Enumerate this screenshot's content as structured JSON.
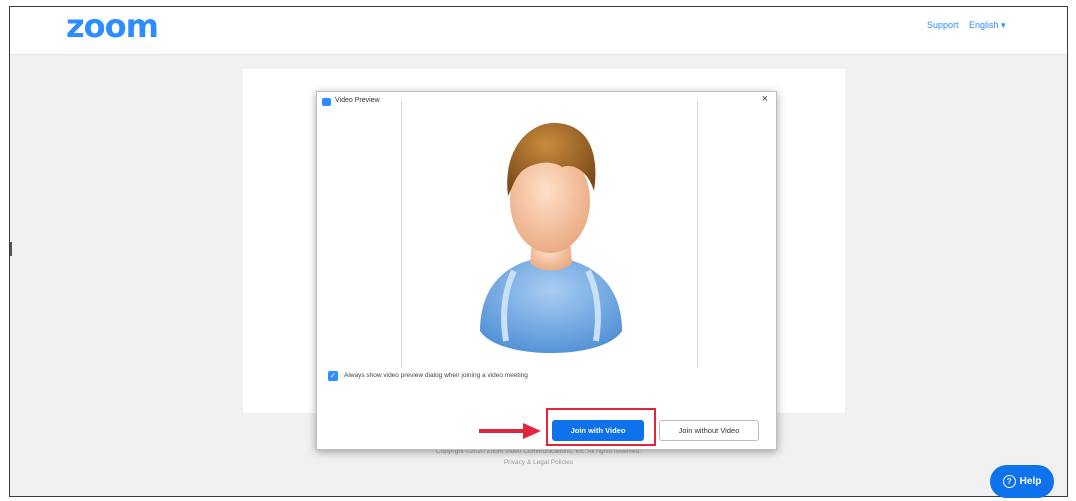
{
  "header": {
    "logo": "zoom",
    "support": "Support",
    "language": "English ▾"
  },
  "dialog": {
    "title": "Video Preview",
    "close": "×",
    "checkbox_label": "Always show video preview dialog when joining a video meeting",
    "join_with_video": "Join with Video",
    "join_without_video": "Join without Video"
  },
  "footer": {
    "copyright": "Copyright ©2020 Zoom Video Communications, Inc. All rights reserved.",
    "privacy": "Privacy & Legal Policies"
  },
  "help": {
    "label": "Help"
  },
  "colors": {
    "brand": "#2d8cff",
    "primary_button": "#0e72ed",
    "highlight": "#e0263c"
  },
  "icons": [
    "video-icon",
    "close-icon",
    "checkbox-checked-icon",
    "avatar-placeholder",
    "arrow-right-icon",
    "help-icon"
  ]
}
